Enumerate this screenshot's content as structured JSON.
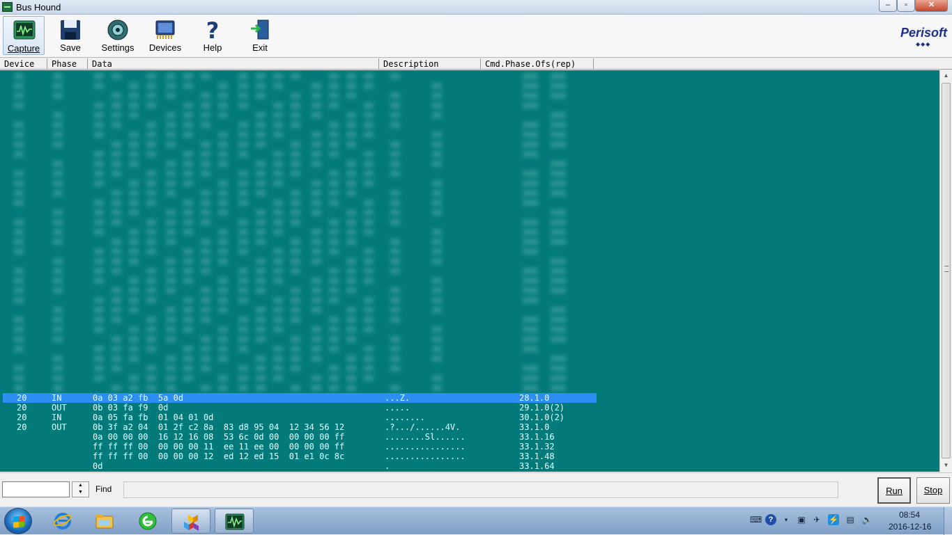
{
  "window": {
    "title": "Bus Hound",
    "min": "–",
    "max": "▫",
    "close": "✕"
  },
  "toolbar": {
    "capture": "Capture",
    "save": "Save",
    "settings": "Settings",
    "devices": "Devices",
    "help": "Help",
    "exit": "Exit",
    "logo": "Perisoft",
    "logo_dots": "◆◆◆"
  },
  "columns": [
    "Device",
    "Phase",
    "Data",
    "Description",
    "Cmd.Phase.Ofs(rep)"
  ],
  "rows": [
    {
      "device": "20",
      "phase": "IN",
      "data": "0a 03 a2 fb  5a 0d",
      "desc": "...Z.",
      "cmd": "28.1.0",
      "selected": true
    },
    {
      "device": "20",
      "phase": "OUT",
      "data": "0b 03 fa f9  0d",
      "desc": ".....",
      "cmd": "29.1.0(2)"
    },
    {
      "device": "20",
      "phase": "IN",
      "data": "0a 05 fa fb  01 04 01 0d",
      "desc": "........",
      "cmd": "30.1.0(2)"
    },
    {
      "device": "20",
      "phase": "OUT",
      "data": "0b 3f a2 04  01 2f c2 8a  83 d8 95 04  12 34 56 12",
      "desc": ".?.../......4V.",
      "cmd": "33.1.0"
    },
    {
      "device": "",
      "phase": "",
      "data": "0a 00 00 00  16 12 16 08  53 6c 0d 00  00 00 00 ff",
      "desc": "........Sl......",
      "cmd": "33.1.16"
    },
    {
      "device": "",
      "phase": "",
      "data": "ff ff ff 00  00 00 00 11  ee 11 ee 00  00 00 00 ff",
      "desc": "................",
      "cmd": "33.1.32"
    },
    {
      "device": "",
      "phase": "",
      "data": "ff ff ff 00  00 00 00 12  ed 12 ed 15  01 e1 0c 8c",
      "desc": "................",
      "cmd": "33.1.48"
    },
    {
      "device": "",
      "phase": "",
      "data": "0d",
      "desc": ".",
      "cmd": "33.1.64"
    }
  ],
  "bottom": {
    "find_label": "Find",
    "find_value": "",
    "run": "Run",
    "stop": "Stop"
  },
  "taskbar": {
    "time": "08:54",
    "date": "2016-12-16"
  },
  "colors": {
    "data_bg": "#037a7a",
    "selected": "#2b8ef0",
    "row_text": "#e8ffff"
  },
  "icons": {
    "capture": "oscilloscope-icon",
    "save": "floppy-disk-icon",
    "settings": "gear-icon",
    "devices": "chip-icon",
    "help": "question-mark-icon",
    "exit": "exit-door-icon"
  }
}
